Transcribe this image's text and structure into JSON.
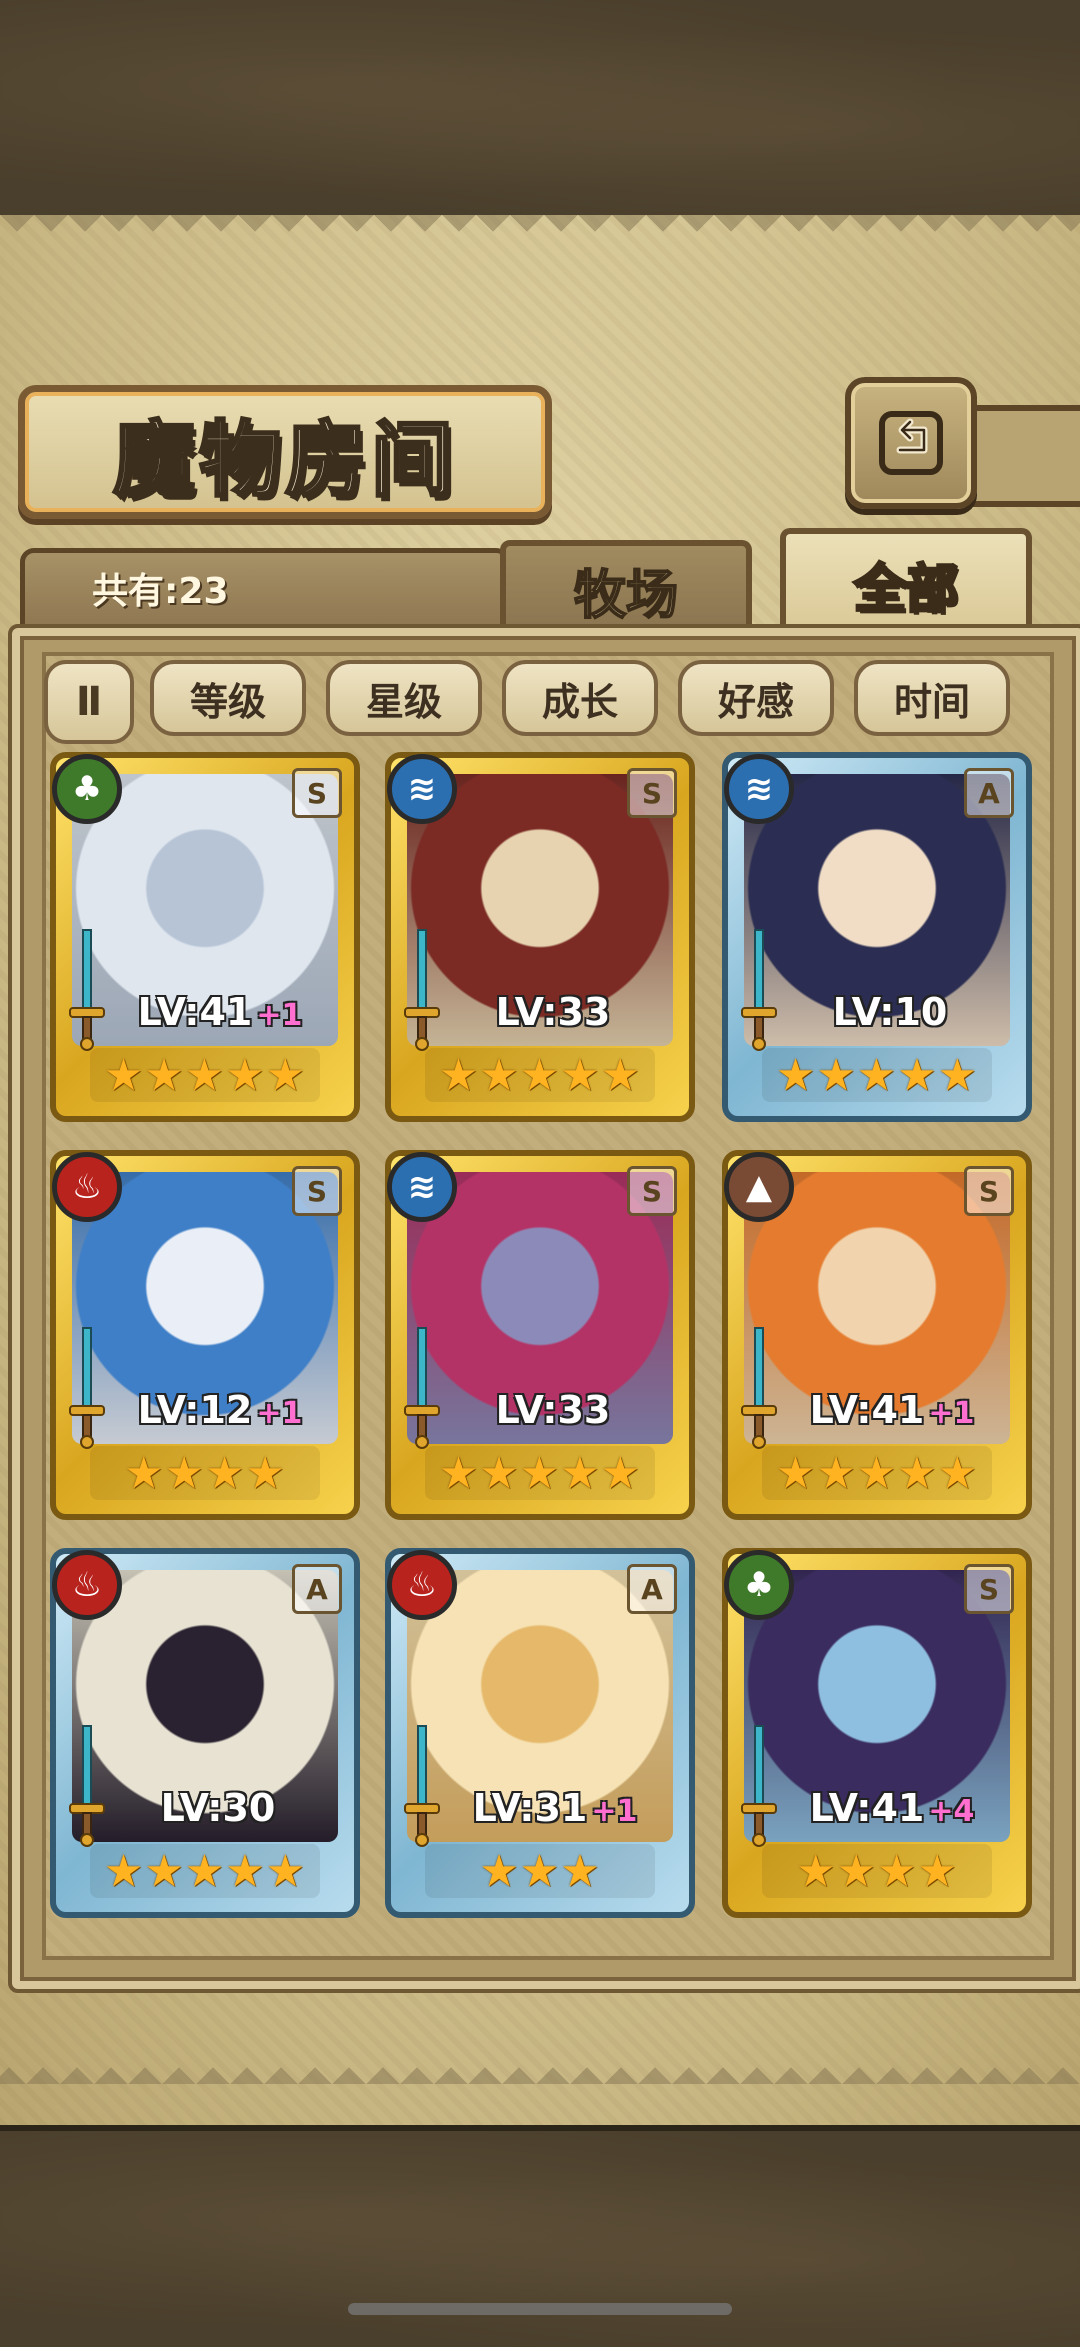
{
  "title": "魔物房间",
  "count_label": "共有:23",
  "tabs": [
    {
      "label": "牧场",
      "active": false
    },
    {
      "label": "全部",
      "active": true
    }
  ],
  "sort_buttons": [
    "等级",
    "星级",
    "成长",
    "好感",
    "时间"
  ],
  "pause_glyph": "Ⅱ",
  "back_glyph": "⮌",
  "cards": [
    {
      "element": "nature",
      "element_glyph": "♣",
      "rank": "S",
      "level": "LV:41",
      "bonus": "+1",
      "stars": "★★★★★",
      "colors": [
        "#dfe6ee",
        "#b7c4d6"
      ]
    },
    {
      "element": "water",
      "element_glyph": "≋",
      "rank": "S",
      "level": "LV:33",
      "bonus": "",
      "stars": "★★★★★",
      "colors": [
        "#7b2a24",
        "#e7d3b0"
      ]
    },
    {
      "element": "water",
      "element_glyph": "≋",
      "rank": "A",
      "level": "LV:10",
      "bonus": "",
      "stars": "★★★★★",
      "colors": [
        "#2b2e52",
        "#f1ddc6"
      ]
    },
    {
      "element": "fire",
      "element_glyph": "♨",
      "rank": "S",
      "level": "LV:12",
      "bonus": "+1",
      "stars": "★★★★",
      "colors": [
        "#3f7fc7",
        "#e9eef7"
      ]
    },
    {
      "element": "water",
      "element_glyph": "≋",
      "rank": "S",
      "level": "LV:33",
      "bonus": "",
      "stars": "★★★★★",
      "colors": [
        "#b43366",
        "#8c8ab8"
      ]
    },
    {
      "element": "earth",
      "element_glyph": "▲",
      "rank": "S",
      "level": "LV:41",
      "bonus": "+1",
      "stars": "★★★★★",
      "colors": [
        "#e57b2e",
        "#f1d4ae"
      ]
    },
    {
      "element": "fire",
      "element_glyph": "♨",
      "rank": "A",
      "level": "LV:30",
      "bonus": "",
      "stars": "★★★★★",
      "colors": [
        "#e7e2d2",
        "#2a2230"
      ]
    },
    {
      "element": "fire",
      "element_glyph": "♨",
      "rank": "A",
      "level": "LV:31",
      "bonus": "+1",
      "stars": "★★★",
      "colors": [
        "#f6e2b4",
        "#e6b86a"
      ]
    },
    {
      "element": "nature",
      "element_glyph": "♣",
      "rank": "S",
      "level": "LV:41",
      "bonus": "+4",
      "stars": "★★★★",
      "colors": [
        "#3a2c5e",
        "#8fbfe0"
      ]
    }
  ]
}
